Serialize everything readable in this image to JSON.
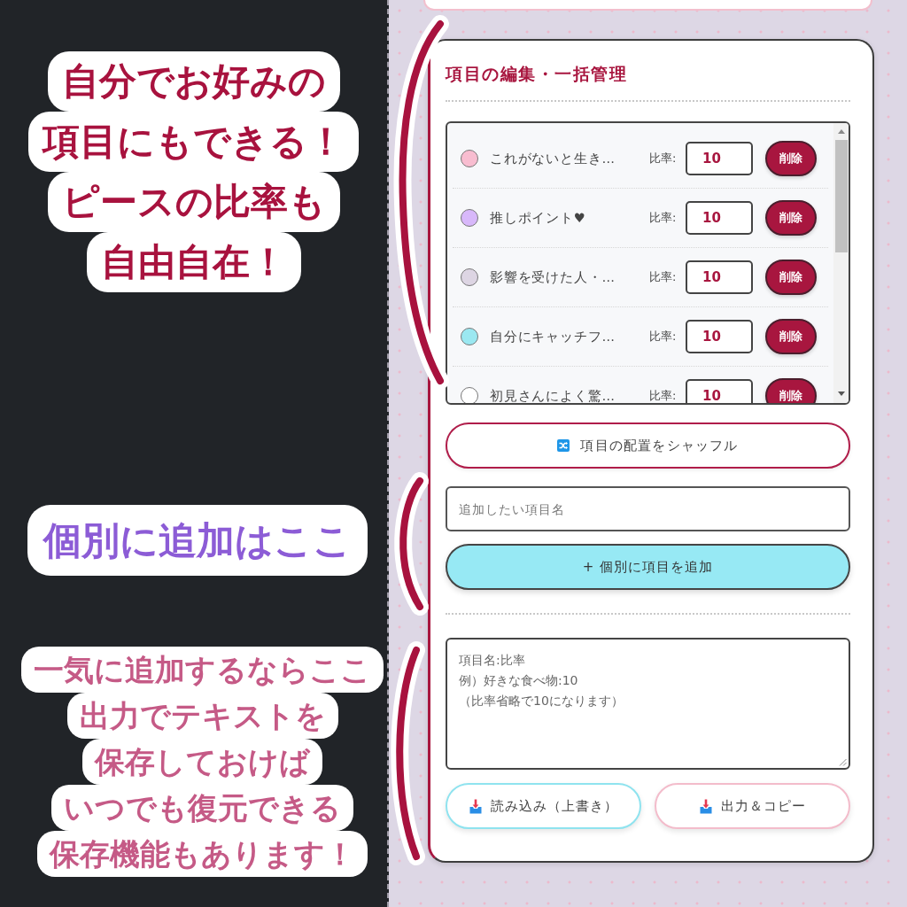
{
  "callouts": [
    {
      "lines": [
        "自分でお好みの",
        "項目にもできる！",
        "ピースの比率も",
        "自由自在！"
      ],
      "color": "#a8123e"
    },
    {
      "lines": [
        "個別に追加はここ"
      ],
      "color": "#8c5cd6"
    },
    {
      "lines": [
        "一気に追加するならここ",
        "出力でテキストを",
        "保存しておけば",
        "いつでも復元できる",
        "保存機能もあります！"
      ],
      "color": "#c55a86"
    }
  ],
  "editor": {
    "title": "項目の編集・一括管理",
    "items": [
      {
        "name": "これがないと生き…",
        "color": "#f8bdd0",
        "ratio_label": "比率:",
        "ratio": "10",
        "delete_label": "削除"
      },
      {
        "name": "推しポイント♥",
        "color": "#d8b8fa",
        "ratio_label": "比率:",
        "ratio": "10",
        "delete_label": "削除"
      },
      {
        "name": "影響を受けた人・…",
        "color": "#ddd5e3",
        "ratio_label": "比率:",
        "ratio": "10",
        "delete_label": "削除"
      },
      {
        "name": "自分にキャッチフ…",
        "color": "#9be8f1",
        "ratio_label": "比率:",
        "ratio": "10",
        "delete_label": "削除"
      },
      {
        "name": "初見さんによく驚…",
        "color": "#ffffff",
        "ratio_label": "比率:",
        "ratio": "10",
        "delete_label": "削除"
      }
    ],
    "shuffle_button": {
      "label": "項目の配置をシャッフル"
    },
    "new_item": {
      "placeholder": "追加したい項目名"
    },
    "add_button": {
      "label": "+ 個別に項目を追加"
    },
    "bulk_text": {
      "placeholder": [
        "項目名:比率",
        "例）好きな食べ物:10",
        "（比率省略で10になります）"
      ]
    },
    "load_button": {
      "label": "読み込み（上書き）"
    },
    "export_button": {
      "label": "出力＆コピー"
    }
  }
}
